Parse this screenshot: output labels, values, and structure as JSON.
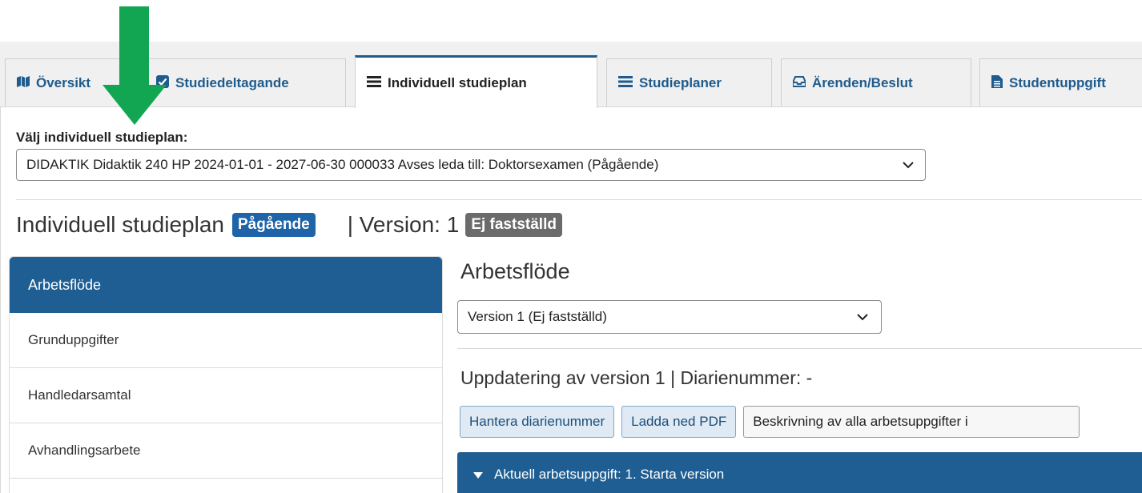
{
  "tabs": [
    {
      "label": "Översikt",
      "icon": "map-icon",
      "active": false
    },
    {
      "label": "Studiedeltagande",
      "icon": "checkbox-icon",
      "active": false
    },
    {
      "label": "Individuell studieplan",
      "icon": "list-icon",
      "active": true
    },
    {
      "label": "Studieplaner",
      "icon": "list-icon",
      "active": false
    },
    {
      "label": "Ärenden/Beslut",
      "icon": "inbox-icon",
      "active": false
    },
    {
      "label": "Studentuppgift",
      "icon": "file-icon",
      "active": false
    }
  ],
  "plan_picker": {
    "label": "Välj individuell studieplan:",
    "selected": "DIDAKTIK Didaktik 240 HP 2024-01-01 - 2027-06-30 000033 Avses leda till: Doktorsexamen (Pågående)"
  },
  "heading": {
    "title": "Individuell studieplan",
    "status_badge": "Pågående",
    "version_text": "| Version: 1",
    "version_badge": "Ej fastställd"
  },
  "leftnav": {
    "items": [
      {
        "label": "Arbetsflöde",
        "active": true
      },
      {
        "label": "Grunduppgifter",
        "active": false
      },
      {
        "label": "Handledarsamtal",
        "active": false
      },
      {
        "label": "Avhandlingsarbete",
        "active": false
      }
    ]
  },
  "main": {
    "title": "Arbetsflöde",
    "version_select": "Version 1 (Ej fastställd)",
    "update_title": "Uppdatering av version 1 | Diarienummer: -",
    "buttons": {
      "manage": "Hantera diarienummer",
      "pdf": "Ladda ned PDF",
      "description": "Beskrivning av alla arbetsuppgifter i"
    },
    "current_task": "Aktuell arbetsuppgift: 1. Starta version"
  },
  "colors": {
    "primary": "#1f5e92",
    "badge_blue": "#1f64a8",
    "badge_gray": "#6b6b6b",
    "annotation_arrow": "#12a652"
  }
}
